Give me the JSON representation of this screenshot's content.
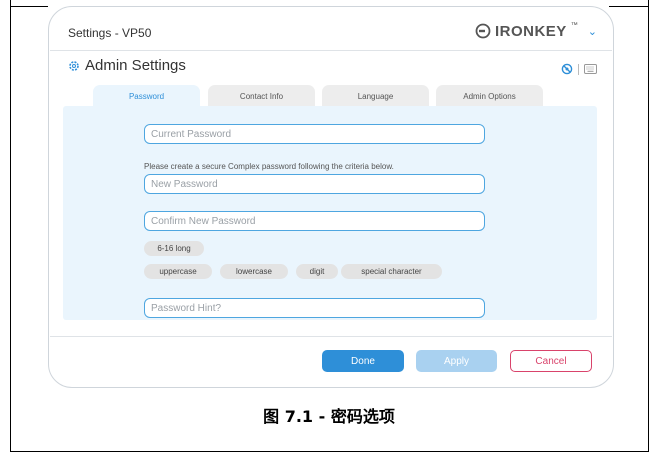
{
  "window": {
    "title": "Settings - VP50",
    "brand": "IRONKEY",
    "brand_tm": "™"
  },
  "section": {
    "title": "Admin Settings"
  },
  "tabs": [
    {
      "label": "Password",
      "active": true
    },
    {
      "label": "Contact Info",
      "active": false
    },
    {
      "label": "Language",
      "active": false
    },
    {
      "label": "Admin Options",
      "active": false
    }
  ],
  "form": {
    "current_password_placeholder": "Current Password",
    "criteria_text": "Please create a secure Complex password following the criteria below.",
    "new_password_placeholder": "New Password",
    "confirm_password_placeholder": "Confirm New Password",
    "criteria": {
      "length": "6-16 long",
      "uppercase": "uppercase",
      "lowercase": "lowercase",
      "digit": "digit",
      "special": "special character"
    },
    "hint_placeholder": "Password Hint?"
  },
  "buttons": {
    "done": "Done",
    "apply": "Apply",
    "cancel": "Cancel"
  },
  "caption": "图 7.1 - 密码选项",
  "colors": {
    "accent": "#2e8fd8",
    "cancel": "#d9436b",
    "panel_bg": "#eaf5fd"
  },
  "icons": [
    "ironkey-logo-icon",
    "chevron-down-icon",
    "gear-icon",
    "eye-hidden-icon",
    "keyboard-icon"
  ]
}
